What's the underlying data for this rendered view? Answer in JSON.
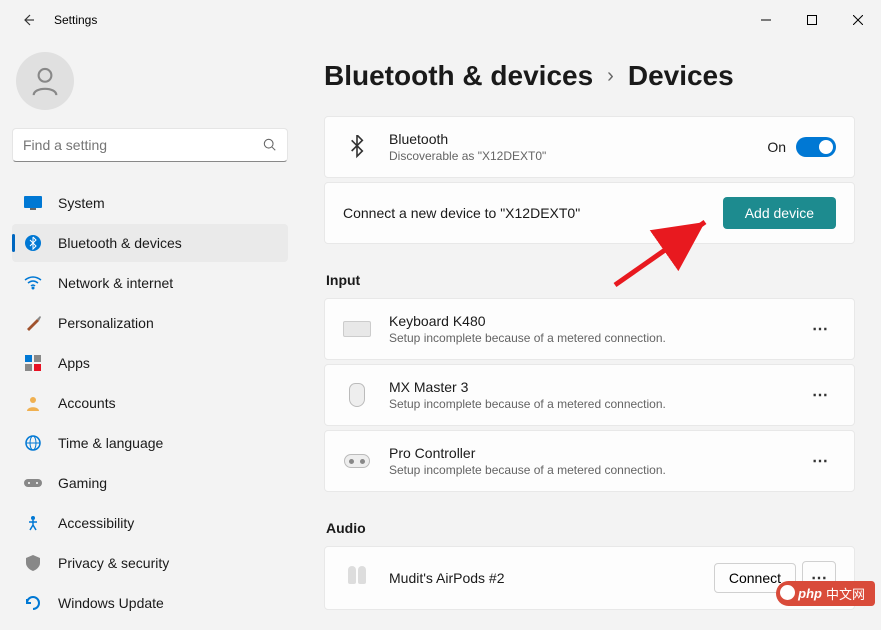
{
  "window": {
    "title": "Settings"
  },
  "search": {
    "placeholder": "Find a setting"
  },
  "nav": [
    {
      "label": "System"
    },
    {
      "label": "Bluetooth & devices"
    },
    {
      "label": "Network & internet"
    },
    {
      "label": "Personalization"
    },
    {
      "label": "Apps"
    },
    {
      "label": "Accounts"
    },
    {
      "label": "Time & language"
    },
    {
      "label": "Gaming"
    },
    {
      "label": "Accessibility"
    },
    {
      "label": "Privacy & security"
    },
    {
      "label": "Windows Update"
    }
  ],
  "breadcrumb": {
    "parent": "Bluetooth & devices",
    "current": "Devices"
  },
  "bluetooth": {
    "title": "Bluetooth",
    "sub": "Discoverable as \"X12DEXT0\"",
    "state": "On"
  },
  "connect": {
    "text": "Connect a new device to \"X12DEXT0\"",
    "button": "Add device"
  },
  "sections": {
    "input": "Input",
    "audio": "Audio"
  },
  "devices": {
    "keyboard": {
      "title": "Keyboard K480",
      "sub": "Setup incomplete because of a metered connection."
    },
    "mouse": {
      "title": "MX Master 3",
      "sub": "Setup incomplete because of a metered connection."
    },
    "controller": {
      "title": "Pro Controller",
      "sub": "Setup incomplete because of a metered connection."
    },
    "airpods": {
      "title": "Mudit's AirPods #2",
      "button": "Connect"
    }
  },
  "badge": {
    "text": "中文网"
  }
}
